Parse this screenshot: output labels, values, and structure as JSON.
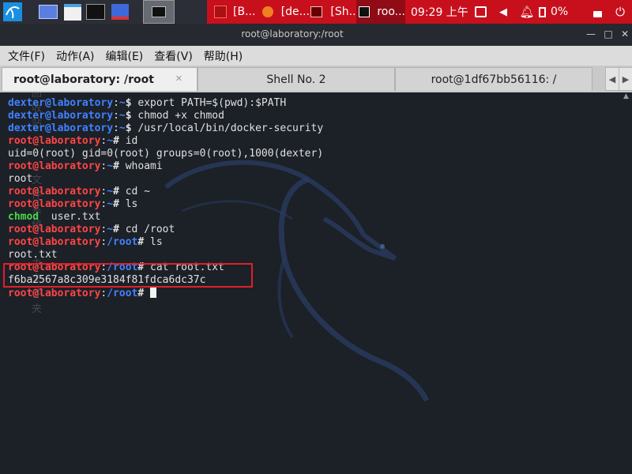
{
  "panel": {
    "tasks": [
      "[B...",
      "[de...",
      "[Sh...",
      "roo..."
    ],
    "clock": "09:29 上午",
    "battery": "0%"
  },
  "window": {
    "title": "root@laboratory:/root"
  },
  "menu": [
    "文件(F)",
    "动作(A)",
    "编辑(E)",
    "查看(V)",
    "帮助(H)"
  ],
  "tabs": [
    {
      "label": "root@laboratory: /root",
      "active": true
    },
    {
      "label": "Shell No. 2",
      "active": false
    },
    {
      "label": "root@1df67bb56116: /",
      "active": false
    }
  ],
  "desktop_ghost": [
    "回收站",
    "文件系统",
    "主文件夹"
  ],
  "terminal": {
    "lines": [
      {
        "user": "dexter@laboratory",
        "path": "~",
        "sym": "$",
        "cmd": " export PATH=$(pwd):$PATH"
      },
      {
        "user": "dexter@laboratory",
        "path": "~",
        "sym": "$",
        "cmd": " chmod +x chmod"
      },
      {
        "user": "dexter@laboratory",
        "path": "~",
        "sym": "$",
        "cmd": " /usr/local/bin/docker-security"
      },
      {
        "user": "root@laboratory",
        "path": "~",
        "sym": "#",
        "cmd": " id"
      },
      {
        "out": "uid=0(root) gid=0(root) groups=0(root),1000(dexter)"
      },
      {
        "user": "root@laboratory",
        "path": "~",
        "sym": "#",
        "cmd": " whoami"
      },
      {
        "out": "root"
      },
      {
        "user": "root@laboratory",
        "path": "~",
        "sym": "#",
        "cmd": " cd ~"
      },
      {
        "user": "root@laboratory",
        "path": "~",
        "sym": "#",
        "cmd": " ls"
      },
      {
        "ls": [
          "chmod",
          "user.txt"
        ]
      },
      {
        "user": "root@laboratory",
        "path": "~",
        "sym": "#",
        "cmd": " cd /root"
      },
      {
        "user": "root@laboratory",
        "path": "/root",
        "sym": "#",
        "cmd": " ls"
      },
      {
        "out": "root.txt"
      },
      {
        "user": "root@laboratory",
        "path": "/root",
        "sym": "#",
        "cmd": " cat root.txt"
      },
      {
        "out": "f6ba2567a8c309e3184f81fdca6dc37c"
      },
      {
        "user": "root@laboratory",
        "path": "/root",
        "sym": "#",
        "cmd": " ",
        "cursor": true
      }
    ]
  },
  "colors": {
    "panel_red": "#c8101d",
    "prompt_blue": "#3f82ff",
    "root_red": "#ff4545",
    "highlight_box": "#e0202a"
  }
}
